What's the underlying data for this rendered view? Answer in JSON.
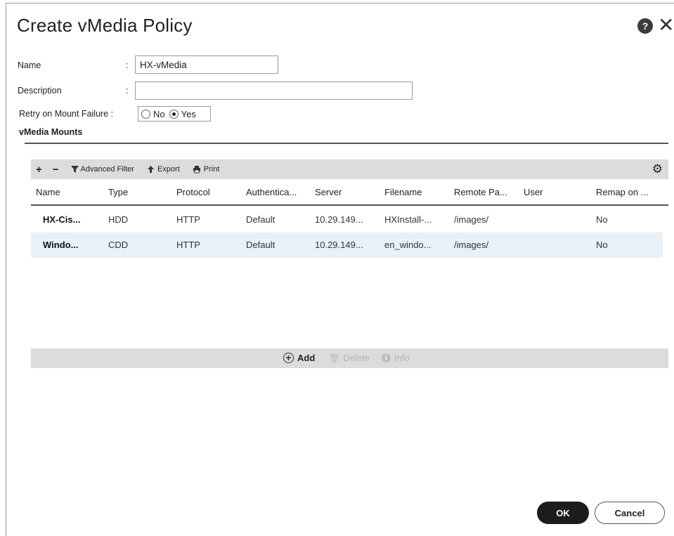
{
  "dialog": {
    "title": "Create vMedia Policy",
    "help_glyph": "?",
    "close_glyph": "✕"
  },
  "form": {
    "name_label": "Name",
    "name_value": "HX-vMedia",
    "description_label": "Description",
    "description_value": "",
    "retry_label": "Retry on Mount Failure :",
    "colon": ":",
    "retry_options": [
      {
        "label": "No",
        "checked": false
      },
      {
        "label": "Yes",
        "checked": true
      }
    ]
  },
  "section": {
    "title": "vMedia Mounts"
  },
  "toolbar": {
    "add_glyph": "+",
    "remove_glyph": "−",
    "filter_label": "Advanced Filter",
    "export_label": "Export",
    "print_label": "Print",
    "icons": [
      "plus-icon",
      "minus-icon",
      "filter-icon",
      "export-icon",
      "print-icon",
      "gear-icon"
    ]
  },
  "table": {
    "columns": [
      "Name",
      "Type",
      "Protocol",
      "Authentica...",
      "Server",
      "Filename",
      "Remote Pa...",
      "User",
      "Remap on ..."
    ],
    "rows": [
      [
        "HX-Cis...",
        "HDD",
        "HTTP",
        "Default",
        "10.29.149...",
        "HXInstall-...",
        "/images/",
        "",
        "No"
      ],
      [
        "Windo...",
        "CDD",
        "HTTP",
        "Default",
        "10.29.149...",
        "en_windo...",
        "/images/",
        "",
        "No"
      ]
    ],
    "selected_row": 1
  },
  "footer_bar": {
    "add_label": "Add",
    "delete_label": "Delete",
    "info_label": "Info"
  },
  "buttons": {
    "ok_label": "OK",
    "cancel_label": "Cancel"
  },
  "colors": {
    "selected_row": "#e6f1f8",
    "toolbar_bg": "#dcdcdc",
    "primary_button": "#1c1c1c"
  }
}
